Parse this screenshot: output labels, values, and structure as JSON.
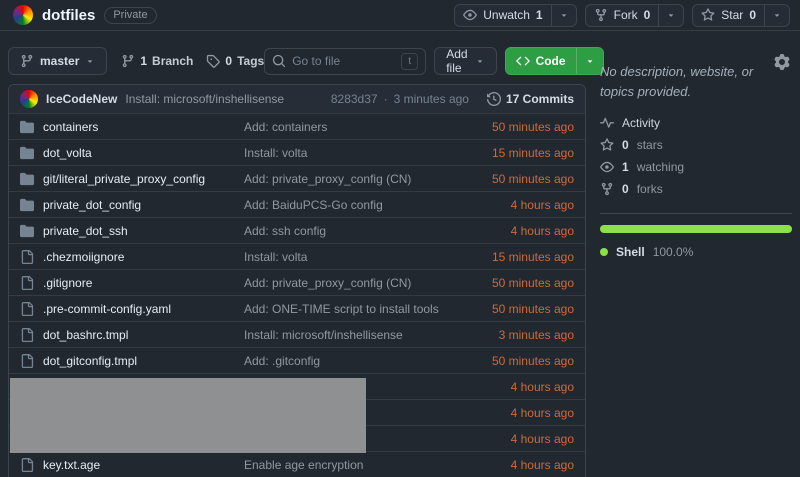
{
  "repo_header": {
    "name": "dotfiles",
    "visibility": "Private",
    "actions": [
      {
        "icon": "eye-icon",
        "label": "Unwatch",
        "count": "1"
      },
      {
        "icon": "fork-icon",
        "label": "Fork",
        "count": "0"
      },
      {
        "icon": "star-icon",
        "label": "Star",
        "count": "0"
      }
    ]
  },
  "toolbar": {
    "branch": "master",
    "branches": {
      "count": "1",
      "label": "Branch"
    },
    "tags": {
      "count": "0",
      "label": "Tags"
    },
    "search_placeholder": "Go to file",
    "search_shortcut": "t",
    "add_file_label": "Add file",
    "code_label": "Code"
  },
  "commit_bar": {
    "author": "IceCodeNew",
    "message": "Install: microsoft/inshellisense",
    "hash": "8283d37",
    "separator": "·",
    "time": "3 minutes ago",
    "commits_label": "17 Commits"
  },
  "files": [
    {
      "type": "folder",
      "name": "containers",
      "message": "Add: containers",
      "time": "50 minutes ago"
    },
    {
      "type": "folder",
      "name": "dot_volta",
      "message": "Install: volta",
      "time": "15 minutes ago"
    },
    {
      "type": "folder",
      "name": "git/literal_private_proxy_config",
      "message": "Add: private_proxy_config (CN)",
      "time": "50 minutes ago"
    },
    {
      "type": "folder",
      "name": "private_dot_config",
      "message": "Add: BaiduPCS-Go config",
      "time": "4 hours ago"
    },
    {
      "type": "folder",
      "name": "private_dot_ssh",
      "message": "Add: ssh config",
      "time": "4 hours ago"
    },
    {
      "type": "file",
      "name": ".chezmoiignore",
      "message": "Install: volta",
      "time": "15 minutes ago"
    },
    {
      "type": "file",
      "name": ".gitignore",
      "message": "Add: private_proxy_config (CN)",
      "time": "50 minutes ago"
    },
    {
      "type": "file",
      "name": ".pre-commit-config.yaml",
      "message": "Add: ONE-TIME script to install tools",
      "time": "50 minutes ago"
    },
    {
      "type": "file",
      "name": "dot_bashrc.tmpl",
      "message": "Install: microsoft/inshellisense",
      "time": "3 minutes ago"
    },
    {
      "type": "file",
      "name": "dot_gitconfig.tmpl",
      "message": "Add: .gitconfig",
      "time": "50 minutes ago"
    },
    {
      "type": "file",
      "name": "",
      "message": "",
      "time": "4 hours ago",
      "redacted": true
    },
    {
      "type": "file",
      "name": "",
      "message": "",
      "time": "4 hours ago",
      "redacted": true
    },
    {
      "type": "file",
      "name": "",
      "message": "",
      "time": "4 hours ago",
      "redacted": true
    },
    {
      "type": "file",
      "name": "key.txt.age",
      "message": "Enable age encryption",
      "time": "4 hours ago"
    }
  ],
  "sidebar": {
    "description": "No description, website, or topics provided.",
    "settings_icon": "gear-icon",
    "stats": [
      {
        "icon": "pulse-icon",
        "count": "",
        "label": "Activity"
      },
      {
        "icon": "star-icon",
        "count": "0",
        "label": "stars"
      },
      {
        "icon": "eye-icon",
        "count": "1",
        "label": "watching"
      },
      {
        "icon": "fork-icon",
        "count": "0",
        "label": "forks"
      }
    ],
    "languages": [
      {
        "name": "Shell",
        "percent": "100.0%",
        "color": "#8ce04a"
      }
    ]
  },
  "colors": {
    "background": "#212830",
    "surface": "#262d37",
    "border": "#3d444d",
    "code_button_green": "#2d9e44",
    "timestamp_orange": "#cc6b39",
    "language_shell_green": "#8ce04a",
    "redaction_gray": "#8e9091"
  }
}
